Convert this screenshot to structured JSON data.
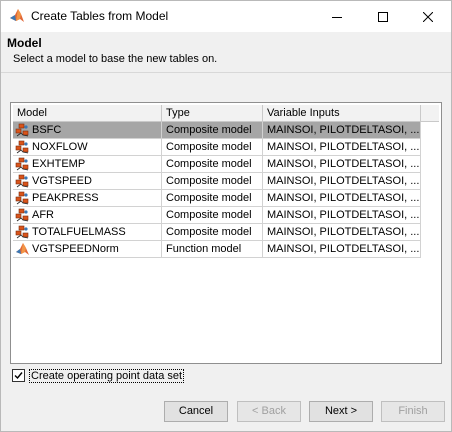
{
  "window": {
    "title": "Create Tables from Model",
    "controls": [
      "minimize-icon",
      "maximize-icon",
      "close-icon"
    ]
  },
  "header": {
    "title": "Model",
    "subtitle": "Select a model to base the new tables on."
  },
  "table": {
    "columns": [
      "Model",
      "Type",
      "Variable Inputs"
    ],
    "rows": [
      {
        "model": "BSFC",
        "type": "Composite model",
        "inputs": "MAINSOI, PILOTDELTASOI, ...",
        "icon": "composite-model-icon",
        "selected": true
      },
      {
        "model": "NOXFLOW",
        "type": "Composite model",
        "inputs": "MAINSOI, PILOTDELTASOI, ...",
        "icon": "composite-model-icon",
        "selected": false
      },
      {
        "model": "EXHTEMP",
        "type": "Composite model",
        "inputs": "MAINSOI, PILOTDELTASOI, ...",
        "icon": "composite-model-icon",
        "selected": false
      },
      {
        "model": "VGTSPEED",
        "type": "Composite model",
        "inputs": "MAINSOI, PILOTDELTASOI, ...",
        "icon": "composite-model-icon",
        "selected": false
      },
      {
        "model": "PEAKPRESS",
        "type": "Composite model",
        "inputs": "MAINSOI, PILOTDELTASOI, ...",
        "icon": "composite-model-icon",
        "selected": false
      },
      {
        "model": "AFR",
        "type": "Composite model",
        "inputs": "MAINSOI, PILOTDELTASOI, ...",
        "icon": "composite-model-icon",
        "selected": false
      },
      {
        "model": "TOTALFUELMASS",
        "type": "Composite model",
        "inputs": "MAINSOI, PILOTDELTASOI, ...",
        "icon": "composite-model-icon",
        "selected": false
      },
      {
        "model": "VGTSPEEDNorm",
        "type": "Function model",
        "inputs": "MAINSOI, PILOTDELTASOI, ...",
        "icon": "function-model-icon",
        "selected": false
      }
    ]
  },
  "options": {
    "create_op_point": {
      "label": "Create operating point data set",
      "checked": true
    }
  },
  "buttons": {
    "cancel": "Cancel",
    "back": "< Back",
    "next": "Next >",
    "finish": "Finish"
  },
  "colors": {
    "selected_row": "#a6a6a6",
    "dialog_bg": "#f0f0f0",
    "icon_orange": "#d9541a"
  }
}
